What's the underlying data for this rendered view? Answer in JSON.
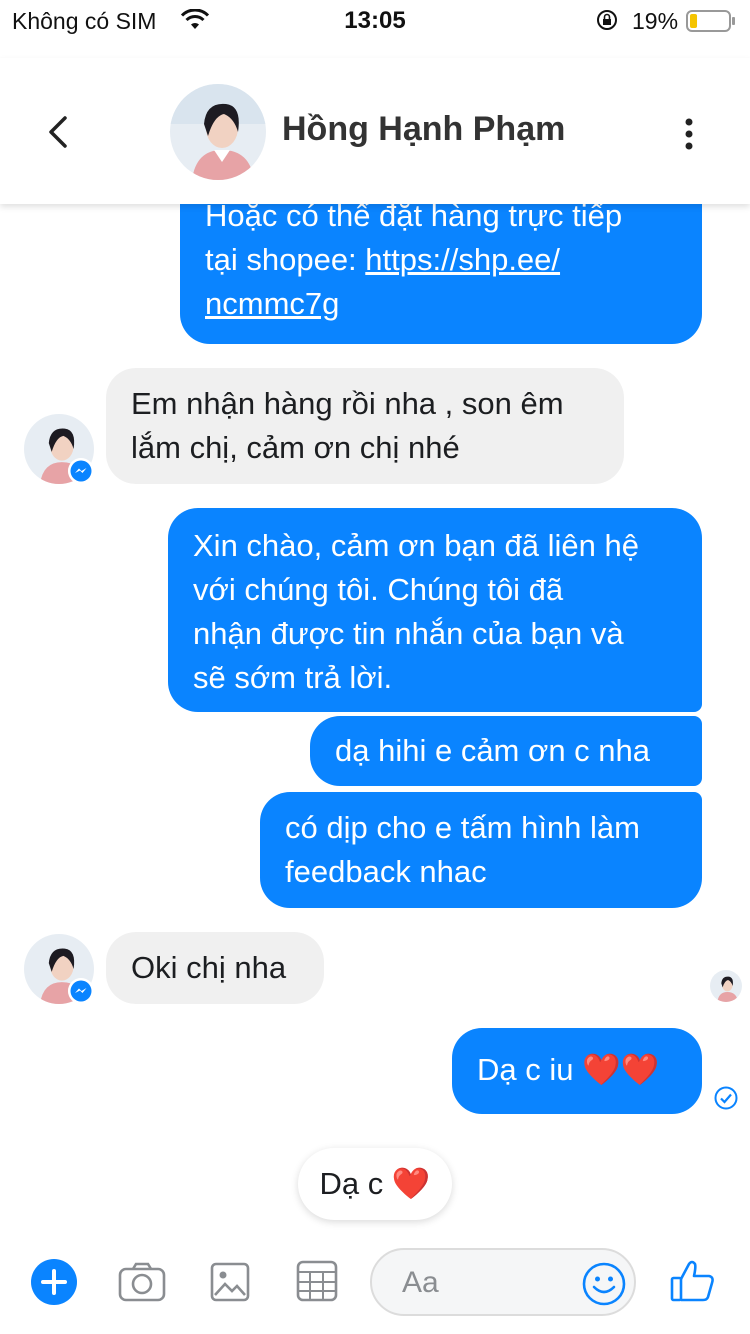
{
  "status_bar": {
    "carrier": "Không có SIM",
    "time": "13:05",
    "battery_percent": "19%",
    "battery_level": 0.19
  },
  "header": {
    "contact_name": "Hồng Hạnh Phạm"
  },
  "messages": [
    {
      "from": "me",
      "lines": [
        "Hoặc có thể đặt hàng trực tiếp",
        "tại shopee: ",
        "https://shp.ee/",
        "ncmmc7g"
      ]
    },
    {
      "from": "them",
      "lines": [
        "Em nhận hàng rồi nha , son êm",
        "lắm chị, cảm ơn chị nhé"
      ]
    },
    {
      "from": "me",
      "lines": [
        "Xin chào, cảm ơn bạn đã liên hệ",
        "với chúng tôi. Chúng tôi đã",
        "nhận được tin nhắn của bạn và",
        "sẽ sớm trả lời."
      ]
    },
    {
      "from": "me",
      "lines": [
        "dạ hihi e cảm ơn c nha"
      ]
    },
    {
      "from": "me",
      "lines": [
        "có dịp cho e tấm hình làm",
        "feedback nhac"
      ]
    },
    {
      "from": "them",
      "lines": [
        "Oki chị nha"
      ]
    },
    {
      "from": "me",
      "lines": [
        "Dạ c iu ❤️❤️"
      ]
    }
  ],
  "reaction_reply": "Dạ c ❤️",
  "composer": {
    "placeholder": "Aa"
  },
  "colors": {
    "outgoing_bubble": "#0a84ff",
    "incoming_bubble": "#f0f0f0",
    "accent": "#0a84ff"
  },
  "icons": [
    "back-icon",
    "more-icon",
    "add-icon",
    "camera-icon",
    "image-icon",
    "sticker-icon",
    "emoji-icon",
    "like-icon",
    "messenger-badge-icon",
    "sent-check-icon"
  ]
}
